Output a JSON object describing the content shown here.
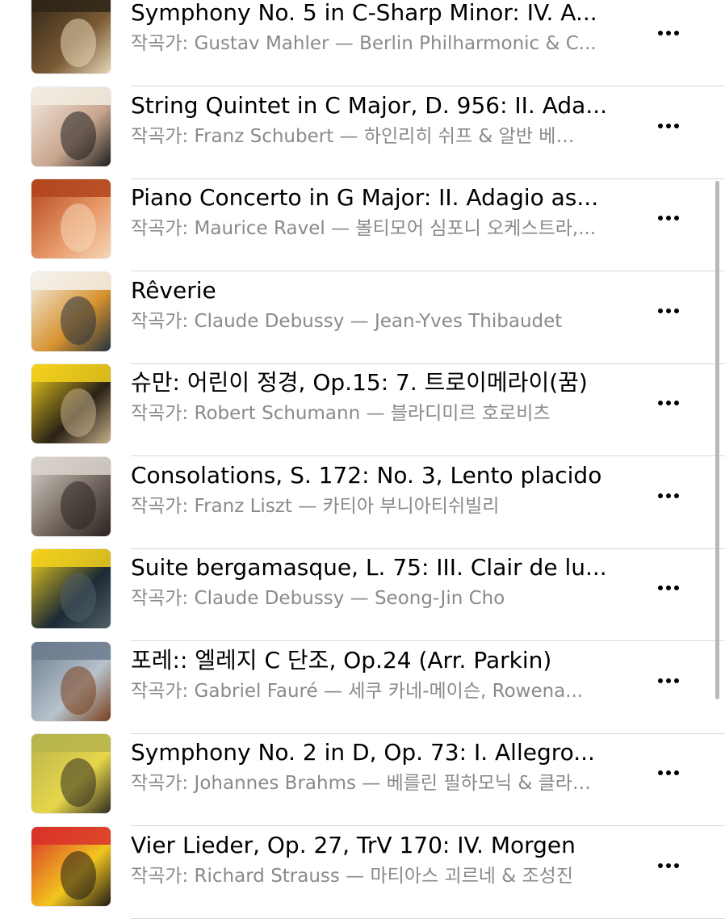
{
  "composer_prefix": "작곡가:",
  "tracks": [
    {
      "title": "Symphony No. 5 in C-Sharp Minor: IV. A...",
      "subtitle": "작곡가: Gustav Mahler — Berlin Philharmonic & C...",
      "art": {
        "palette": [
          "#2e2416",
          "#7a5a34",
          "#e6d7b7"
        ],
        "icon": "album-art-mahler-icon"
      }
    },
    {
      "title": "String Quintet in C Major, D. 956: II. Ada...",
      "subtitle": "작곡가: Franz Schubert — 하인리히 쉬프 & 알반 베…",
      "art": {
        "palette": [
          "#f2ece1",
          "#c9a58e",
          "#1f1f1f"
        ],
        "icon": "album-art-schubert-icon"
      }
    },
    {
      "title": "Piano Concerto in G Major: II. Adagio as...",
      "subtitle": "작곡가: Maurice Ravel — 볼티모어 심포니 오케스트라,...",
      "art": {
        "palette": [
          "#b3451c",
          "#e89a6a",
          "#f5d7b8"
        ],
        "icon": "album-art-grimaud-icon"
      }
    },
    {
      "title": "Rêverie",
      "subtitle": "작곡가: Claude Debussy — Jean-Yves Thibaudet",
      "art": {
        "palette": [
          "#f4f1ea",
          "#d7922e",
          "#25323f"
        ],
        "icon": "album-art-thibaudet-icon"
      }
    },
    {
      "title": "슈만: 어린이 정경, Op.15: 7. 트로이메라이(꿈)",
      "subtitle": "작곡가: Robert Schumann — 블라디미르 호로비츠",
      "art": {
        "palette": [
          "#f4d21c",
          "#2a2216",
          "#c7b08a"
        ],
        "icon": "album-art-horowitz-icon"
      }
    },
    {
      "title": "Consolations, S. 172: No. 3, Lento placido",
      "subtitle": "작곡가: Franz Liszt — 카티아 부니아티쉬빌리",
      "art": {
        "palette": [
          "#d9d4cc",
          "#6e625a",
          "#2a2420"
        ],
        "icon": "album-art-buniatishvili-icon"
      }
    },
    {
      "title": "Suite bergamasque, L. 75: III. Clair de lu...",
      "subtitle": "작곡가: Claude Debussy — Seong-Jin Cho",
      "art": {
        "palette": [
          "#f3d21c",
          "#1d2a35",
          "#4f5f68"
        ],
        "icon": "album-art-cho-icon"
      }
    },
    {
      "title": "포레:: 엘레지 C 단조, Op.24 (Arr. Parkin)",
      "subtitle": "작곡가: Gabriel Fauré — 세쿠 카네-메이슨, Rowena...",
      "art": {
        "palette": [
          "#6d7d8e",
          "#b7c2cc",
          "#7a3f1c"
        ],
        "icon": "album-art-sheku-icon"
      }
    },
    {
      "title": "Symphony No. 2 in D, Op. 73: I. Allegro...",
      "subtitle": "작곡가: Johannes Brahms — 베를린 필하모닉 & 클라…",
      "art": {
        "palette": [
          "#b6b44e",
          "#e8d64a",
          "#2d2c20"
        ],
        "icon": "album-art-brahms-icon"
      }
    },
    {
      "title": "Vier Lieder, Op. 27, TrV 170: IV. Morgen",
      "subtitle": "작곡가: Richard Strauss — 마티아스 괴르네 & 조성진",
      "art": {
        "palette": [
          "#d9312a",
          "#f2c61f",
          "#1f1a17"
        ],
        "icon": "album-art-strauss-icon"
      }
    }
  ],
  "more_button_icon": "ellipsis-icon"
}
